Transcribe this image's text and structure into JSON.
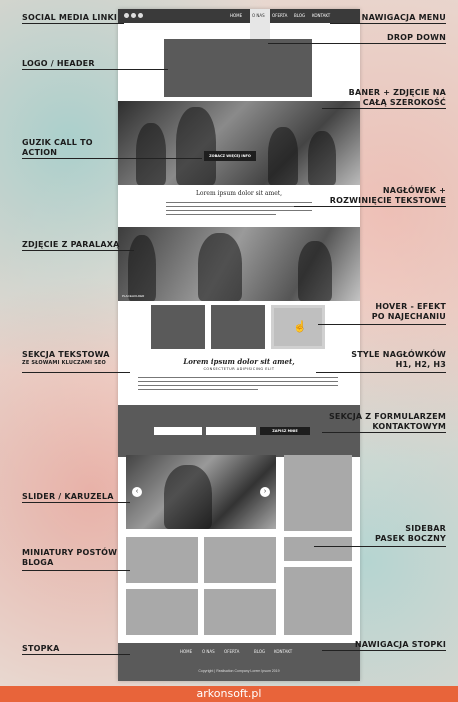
{
  "labels": {
    "social": "SOCIAL MEDIA LINKI",
    "nav_menu": "NAWIGACJA MENU",
    "dropdown": "DROP DOWN",
    "logo": "LOGO / HEADER",
    "banner_1": "BANER + ZDJĘCIE NA",
    "banner_2": "CAŁĄ SZEROKOŚĆ",
    "cta_1": "GUZIK CALL TO",
    "cta_2": "ACTION",
    "heading_1": "NAGŁÓWEK +",
    "heading_2": "ROZWINIĘCIE TEKSTOWE",
    "parallax": "ZDJĘCIE Z PARALAXĄ",
    "hover_1": "HOVER - EFEKT",
    "hover_2": "PO NAJECHANIU",
    "text_section": "SEKCJA TEKSTOWA",
    "text_section_sub": "ZE SŁOWAMI KLUCZAMI SEO",
    "heading_styles_1": "STYLE NAGŁÓWKÓW",
    "heading_styles_2": "H1, H2, H3",
    "form_1": "SEKCJA Z  FORMULARZEM",
    "form_2": "KONTAKTOWYM",
    "slider": "SLIDER / KARUZELA",
    "sidebar_1": "SIDEBAR",
    "sidebar_2": "PASEK BOCZNY",
    "thumbs_1": "MINIATURY POSTÓW",
    "thumbs_2": "BLOGA",
    "footer": "STOPKA",
    "footer_nav": "NAWIGACJA STOPKI"
  },
  "mock": {
    "nav": [
      "HOME",
      "O NAS",
      "OFERTA",
      "BLOG",
      "KONTAKT"
    ],
    "cta_button": "ZOBACZ WIĘCEJ INFO",
    "section_title": "Lorem ipsum dolor sit amet,",
    "parallax_caption": "PLACEHOLDER",
    "h1": "Lorem ipsum dolor sit amet,",
    "h2": "CONSECTETUR ADIPISICING ELIT",
    "form_button": "ZAPISZ MNIE",
    "footer_nav": [
      "HOME",
      "O NAS",
      "OFERTA",
      "BLOG",
      "KONTAKT"
    ],
    "copyright": "Copyright | Realisation Company Lorem Ipsum 2019"
  },
  "brand": "arkonsoft.pl",
  "colors": {
    "brand_bar": "#e8643a",
    "dark_section": "#5a5a5a",
    "placeholder": "#a9a9a9"
  }
}
